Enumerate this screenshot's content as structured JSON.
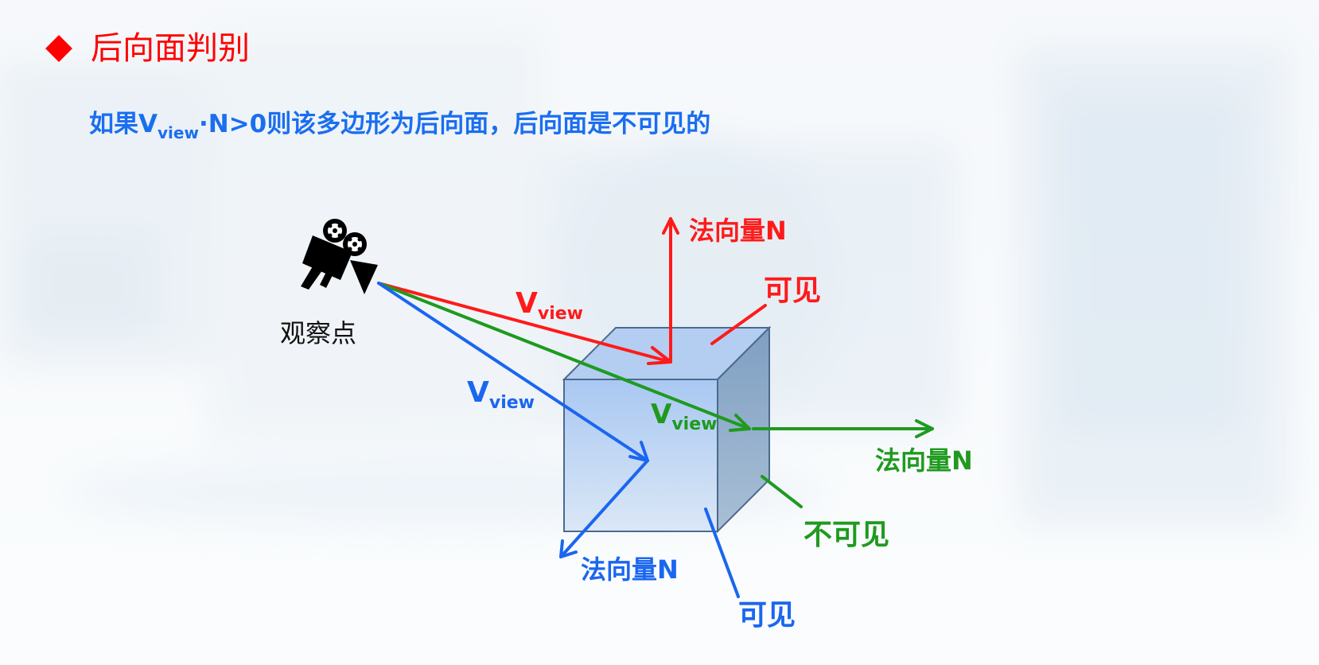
{
  "title": "后向面判别",
  "subtitle": {
    "prefix": "如果V",
    "sub": "view",
    "suffix": "·N>0则该多边形为后向面，后向面是不可见的"
  },
  "viewpoint_label": "观察点",
  "vectors": {
    "red": {
      "v_main": "V",
      "v_sub": "view",
      "normal_label": "法向量N",
      "visibility_label": "可见"
    },
    "green": {
      "v_main": "V",
      "v_sub": "view",
      "normal_label": "法向量N",
      "visibility_label": "不可见"
    },
    "blue": {
      "v_main": "V",
      "v_sub": "view",
      "normal_label": "法向量N",
      "visibility_label": "可见"
    }
  },
  "colors": {
    "title": "#ff0000",
    "red": "#ff1a1a",
    "green": "#1f9a1f",
    "blue": "#1a66f0",
    "cube_edge": "#4b6a8c"
  },
  "icons": {
    "viewpoint": "movie-camera-icon"
  }
}
